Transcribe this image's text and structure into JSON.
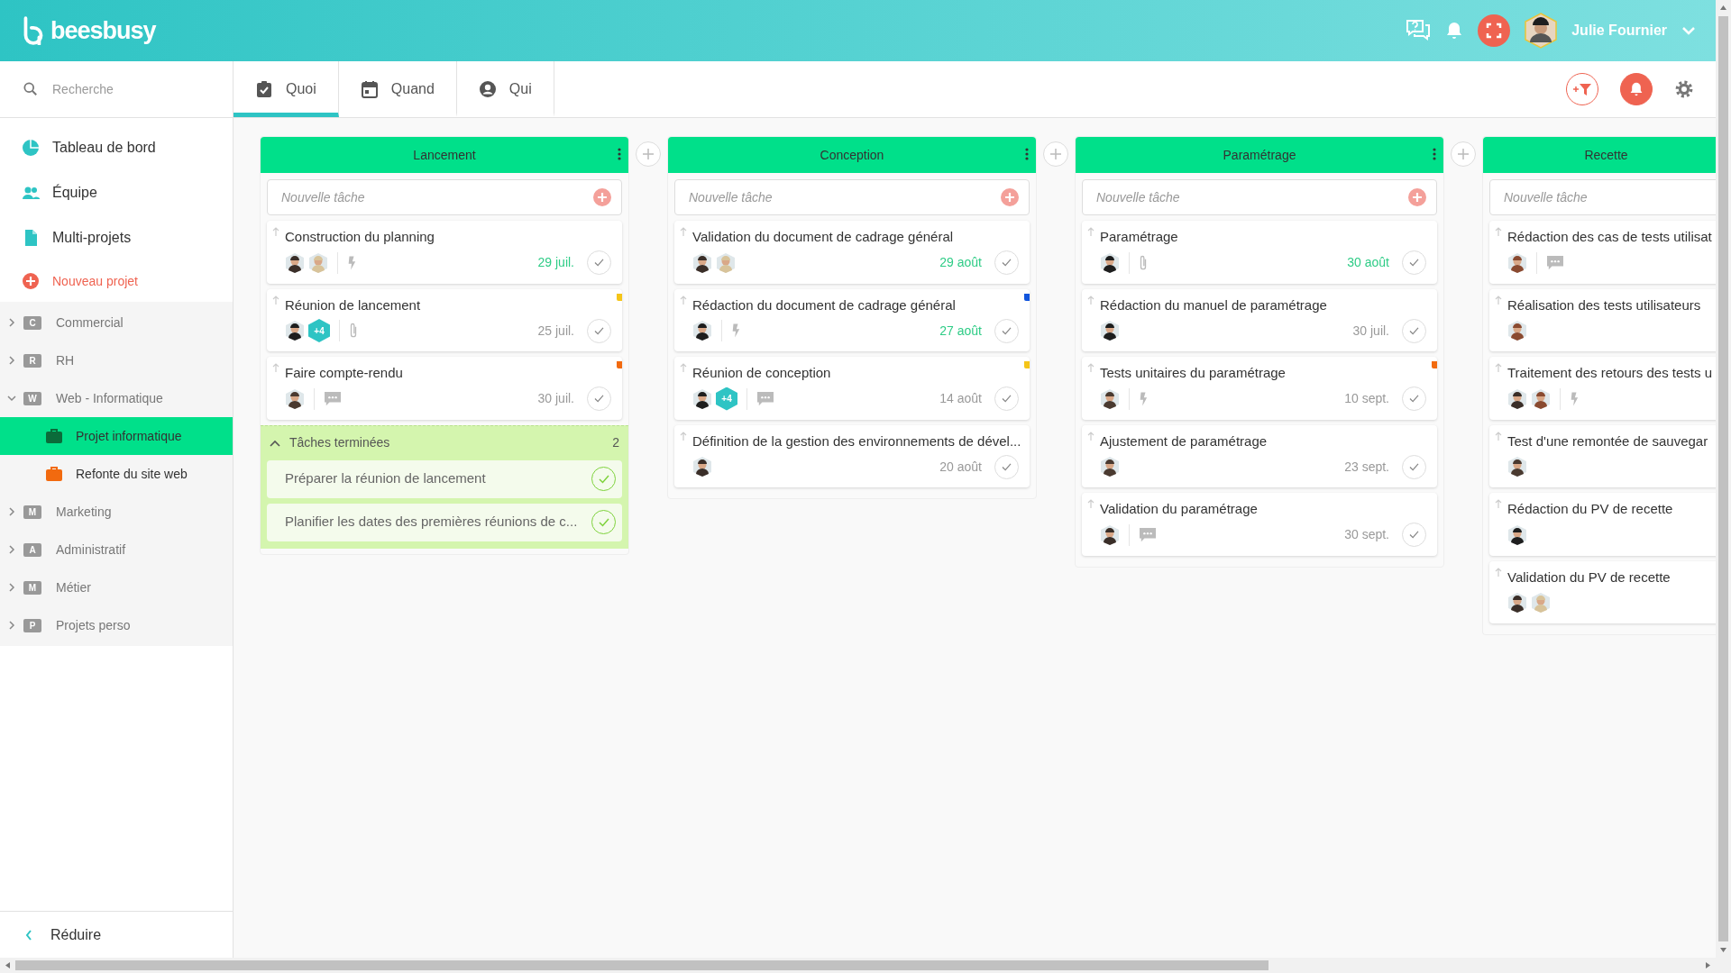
{
  "brand": "beesbusy",
  "header": {
    "user_name": "Julie Fournier"
  },
  "search": {
    "placeholder": "Recherche"
  },
  "nav": [
    {
      "label": "Tableau de bord",
      "kind": "dashboard"
    },
    {
      "label": "Équipe",
      "kind": "team"
    },
    {
      "label": "Multi-projets",
      "kind": "multi"
    },
    {
      "label": "Nouveau projet",
      "kind": "new"
    }
  ],
  "projects": [
    {
      "label": "Commercial",
      "letter": "C",
      "expanded": false
    },
    {
      "label": "RH",
      "letter": "R",
      "expanded": false
    },
    {
      "label": "Web - Informatique",
      "letter": "W",
      "expanded": true,
      "children": [
        {
          "label": "Projet informatique",
          "selected": true,
          "color": "#0b6b3a"
        },
        {
          "label": "Refonte du site web",
          "selected": false,
          "color": "#f26a0f"
        }
      ]
    },
    {
      "label": "Marketing",
      "letter": "M",
      "expanded": false
    },
    {
      "label": "Administratif",
      "letter": "A",
      "expanded": false
    },
    {
      "label": "Métier",
      "letter": "M",
      "expanded": false
    },
    {
      "label": "Projets perso",
      "letter": "P",
      "expanded": false
    }
  ],
  "collapse_label": "Réduire",
  "tabs": [
    {
      "label": "Quoi",
      "kind": "task",
      "selected": true
    },
    {
      "label": "Quand",
      "kind": "calendar",
      "selected": false
    },
    {
      "label": "Qui",
      "kind": "person",
      "selected": false
    }
  ],
  "columns": [
    {
      "title": "Lancement",
      "menu": true,
      "placeholder": "Nouvelle tâche",
      "tasks": [
        {
          "title": "Construction du planning",
          "avatars": [
            {
              "color": "#3a2e28"
            },
            {
              "color": "#d8c39a"
            }
          ],
          "kind": "bolt",
          "due": "29 juil.",
          "due_soon": true
        },
        {
          "title": "Réunion de lancement",
          "color": "#f5c518",
          "avatars": [
            {
              "color": "#1e1e1e"
            }
          ],
          "more": "+4",
          "kind": "clip",
          "due": "25 juil.",
          "due_soon": false
        },
        {
          "title": "Faire compte-rendu",
          "color": "#f26a0f",
          "avatars": [
            {
              "color": "#4a3a30"
            }
          ],
          "kind": "comment",
          "due": "30 juil.",
          "due_soon": false
        }
      ],
      "done": {
        "title": "Tâches terminées",
        "count": "2",
        "expanded": true,
        "tasks": [
          "Préparer la réunion de lancement",
          "Planifier les dates des premières réunions de c..."
        ]
      }
    },
    {
      "title": "Conception",
      "menu": true,
      "placeholder": "Nouvelle tâche",
      "tasks": [
        {
          "title": "Validation du document de cadrage général",
          "avatars": [
            {
              "color": "#3a2e28"
            },
            {
              "color": "#d8c39a"
            }
          ],
          "due": "29 août",
          "due_soon": true
        },
        {
          "title": "Rédaction du document de cadrage général",
          "color": "#1155dd",
          "avatars": [
            {
              "color": "#1e1e1e"
            }
          ],
          "kind": "bolt",
          "due": "27 août",
          "due_soon": true
        },
        {
          "title": "Réunion de conception",
          "color": "#f5c518",
          "avatars": [
            {
              "color": "#1e1e1e"
            }
          ],
          "more": "+4",
          "kind": "comment",
          "due": "14 août",
          "due_soon": false
        },
        {
          "title": "Définition de la gestion des environnements de dével...",
          "avatars": [
            {
              "color": "#3a2e28"
            }
          ],
          "due": "20 août",
          "due_soon": false
        }
      ]
    },
    {
      "title": "Paramétrage",
      "menu": true,
      "placeholder": "Nouvelle tâche",
      "tasks": [
        {
          "title": "Paramétrage",
          "avatars": [
            {
              "color": "#1e1e1e"
            }
          ],
          "kind": "clip",
          "due": "30 août",
          "due_soon": true
        },
        {
          "title": "Rédaction du manuel de paramétrage",
          "avatars": [
            {
              "color": "#1e1e1e"
            }
          ],
          "due": "30 juil.",
          "due_soon": false
        },
        {
          "title": "Tests unitaires du paramétrage",
          "color": "#f26a0f",
          "avatars": [
            {
              "color": "#4a3a30"
            }
          ],
          "kind": "bolt",
          "due": "10 sept.",
          "due_soon": false
        },
        {
          "title": "Ajustement de paramétrage",
          "avatars": [
            {
              "color": "#4a3a30"
            }
          ],
          "due": "23 sept.",
          "due_soon": false
        },
        {
          "title": "Validation du paramétrage",
          "avatars": [
            {
              "color": "#3a2e28"
            }
          ],
          "kind": "comment",
          "due": "30 sept.",
          "due_soon": false
        }
      ]
    },
    {
      "title": "Recette",
      "menu": false,
      "placeholder": "Nouvelle tâche",
      "tasks": [
        {
          "title": "Rédaction des cas de tests utilisat",
          "avatars": [
            {
              "color": "#8a4a30"
            }
          ],
          "kind": "comment"
        },
        {
          "title": "Réalisation des tests utilisateurs",
          "avatars": [
            {
              "color": "#8a4a30"
            }
          ]
        },
        {
          "title": "Traitement des retours des tests u",
          "avatars": [
            {
              "color": "#3a2e28"
            },
            {
              "color": "#8a4a30"
            }
          ],
          "kind": "bolt"
        },
        {
          "title": "Test d'une remontée de sauvegar",
          "avatars": [
            {
              "color": "#4a3a30"
            }
          ]
        },
        {
          "title": "Rédaction du PV de recette",
          "avatars": [
            {
              "color": "#1e1e1e"
            }
          ]
        },
        {
          "title": "Validation du PV de recette",
          "avatars": [
            {
              "color": "#3a2e28"
            },
            {
              "color": "#d8c39a"
            }
          ]
        }
      ]
    }
  ]
}
